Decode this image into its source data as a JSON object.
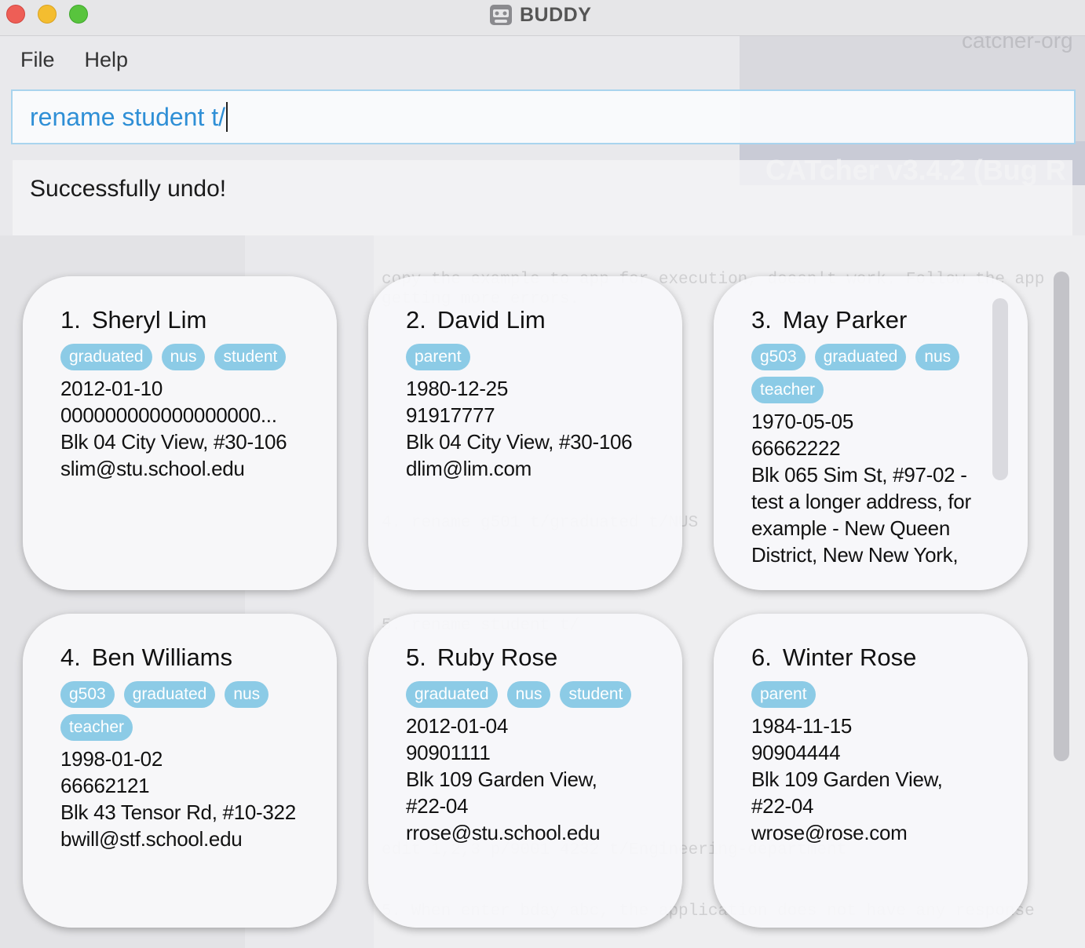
{
  "window": {
    "title": "BUDDY"
  },
  "menu": {
    "items": [
      {
        "label": "File"
      },
      {
        "label": "Help"
      }
    ]
  },
  "command_box": {
    "value": "rename student t/"
  },
  "result_display": {
    "text": "Successfully undo!"
  },
  "background_window": {
    "title": "CATcher v3.4.2 (Bug R",
    "url": "catcher-org",
    "lines": [
      "copy the example to app for execution, doesn't work. Follow the app",
      "getting more errors.",
      "4. rename g501 t/graduated t/NUS",
      "5. rename student t/",
      "edit 1,2,3 p/9001 4232 t/Engineering-department",
      "5. When enter bday abc, the application does not have any response"
    ]
  },
  "colors": {
    "tag_bg": "#8ccbe6",
    "command_text": "#2f8fd6",
    "command_border": "#a9d4ee"
  },
  "persons": [
    {
      "index": "1.",
      "name": "Sheryl Lim",
      "tags": [
        "graduated",
        "nus",
        "student"
      ],
      "birthday": "2012-01-10",
      "phone": "000000000000000000...",
      "address": "Blk 04 City View, #30-106",
      "email": "slim@stu.school.edu"
    },
    {
      "index": "2.",
      "name": "David Lim",
      "tags": [
        "parent"
      ],
      "birthday": "1980-12-25",
      "phone": "91917777",
      "address": "Blk 04 City View, #30-106",
      "email": "dlim@lim.com"
    },
    {
      "index": "3.",
      "name": "May Parker",
      "tags": [
        "g503",
        "graduated",
        "nus",
        "teacher"
      ],
      "birthday": "1970-05-05",
      "phone": "66662222",
      "address": "Blk 065 Sim St, #97-02 - test a longer address, for example - New Queen District, New New York,",
      "email": ""
    },
    {
      "index": "4.",
      "name": "Ben Williams",
      "tags": [
        "g503",
        "graduated",
        "nus",
        "teacher"
      ],
      "birthday": "1998-01-02",
      "phone": "66662121",
      "address": "Blk 43 Tensor Rd, #10-322",
      "email": "bwill@stf.school.edu"
    },
    {
      "index": "5.",
      "name": "Ruby Rose",
      "tags": [
        "graduated",
        "nus",
        "student"
      ],
      "birthday": "2012-01-04",
      "phone": "90901111",
      "address": "Blk 109 Garden View, #22-04",
      "email": "rrose@stu.school.edu"
    },
    {
      "index": "6.",
      "name": "Winter Rose",
      "tags": [
        "parent"
      ],
      "birthday": "1984-11-15",
      "phone": "90904444",
      "address": "Blk 109 Garden View, #22-04",
      "email": "wrose@rose.com"
    }
  ]
}
